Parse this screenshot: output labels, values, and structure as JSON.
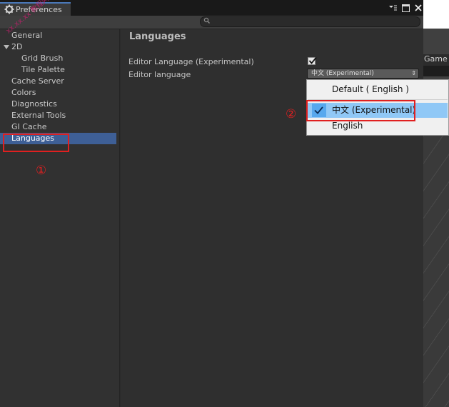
{
  "window": {
    "tab_title": "Preferences",
    "tab_icon": "gear-icon",
    "controls": [
      "menu-icon",
      "maximize-icon",
      "close-icon"
    ]
  },
  "search": {
    "placeholder": ""
  },
  "sidebar": {
    "items": [
      {
        "label": "General",
        "indent": 0
      },
      {
        "label": "2D",
        "indent": 0,
        "expanded": true
      },
      {
        "label": "Grid Brush",
        "indent": 1
      },
      {
        "label": "Tile Palette",
        "indent": 1
      },
      {
        "label": "Cache Server",
        "indent": 0
      },
      {
        "label": "Colors",
        "indent": 0
      },
      {
        "label": "Diagnostics",
        "indent": 0
      },
      {
        "label": "External Tools",
        "indent": 0
      },
      {
        "label": "GI Cache",
        "indent": 0
      },
      {
        "label": "Languages",
        "indent": 0,
        "selected": true
      }
    ]
  },
  "main": {
    "heading": "Languages",
    "fields": [
      {
        "label": "Editor Language (Experimental)",
        "type": "checkbox",
        "checked": true
      },
      {
        "label": "Editor language",
        "type": "dropdown",
        "value": "中文 (Experimental)"
      }
    ]
  },
  "popup": {
    "items": [
      {
        "label": "Default ( English )",
        "selected": false
      },
      {
        "label": "中文 (Experimental)",
        "selected": true
      },
      {
        "label": "English",
        "selected": false
      }
    ]
  },
  "background": {
    "game_tab": "Game"
  },
  "annotations": {
    "marker_1": "①",
    "marker_2": "②",
    "watermark": "xx.xx.xx 教程网"
  },
  "colors": {
    "selection": "#3e5f96",
    "annotation_red": "#e02020",
    "popup_highlight": "#90c8f6"
  }
}
